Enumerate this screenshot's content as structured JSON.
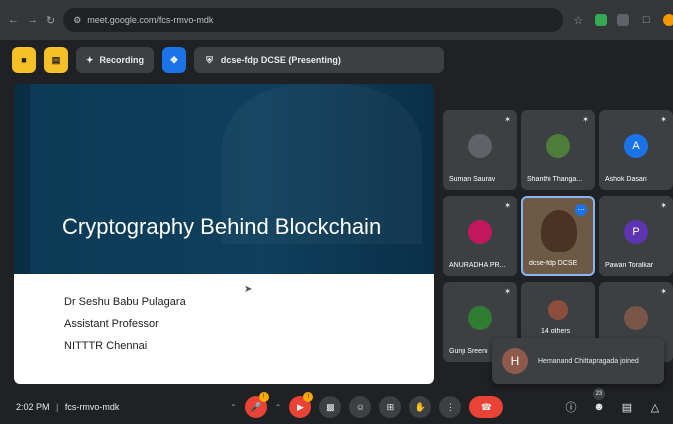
{
  "browser": {
    "url": "meet.google.com/fcs-rmvo-mdk"
  },
  "meet_top": {
    "recording_label": "Recording",
    "presenting_label": "dcse-fdp DCSE (Presenting)"
  },
  "slide": {
    "title": "Cryptography Behind Blockchain",
    "presenter_name": "Dr Seshu Babu Pulagara",
    "presenter_role": "Assistant Professor",
    "presenter_org": "NITTTR Chennai"
  },
  "participants": [
    {
      "name": "Suman Saurav",
      "avatar_color": "#5f6368"
    },
    {
      "name": "Shanthi Thanga...",
      "avatar_color": "#5f6368"
    },
    {
      "name": "Ashok Dasari",
      "initial": "A",
      "avatar_color": "#1a73e8"
    },
    {
      "name": "ANURADHA PR...",
      "avatar_color": "#c2185b"
    },
    {
      "name": "dcse-fdp DCSE",
      "active": true
    },
    {
      "name": "Pawan Toralkar",
      "initial": "P",
      "avatar_color": "#5e35b1"
    },
    {
      "name": "Gunji Sreeni",
      "avatar_color": "#2e7d32"
    },
    {
      "name": "14 others",
      "avatar_color": "#8d4d3d"
    },
    {
      "name": "",
      "avatar_color": "#795548"
    }
  ],
  "toast": {
    "initial": "H",
    "message": "Hemanand Chittapragada joined"
  },
  "bottom": {
    "time": "2:02 PM",
    "separator": "|",
    "meeting_code": "fcs-rmvo-mdk",
    "mic_badge": "!",
    "cam_badge": "!",
    "people_count": "23"
  },
  "colors": {
    "accent": "#1a73e8",
    "danger": "#ea4335",
    "warning": "#f9ab00",
    "chip_yellow": "#f6c026"
  }
}
